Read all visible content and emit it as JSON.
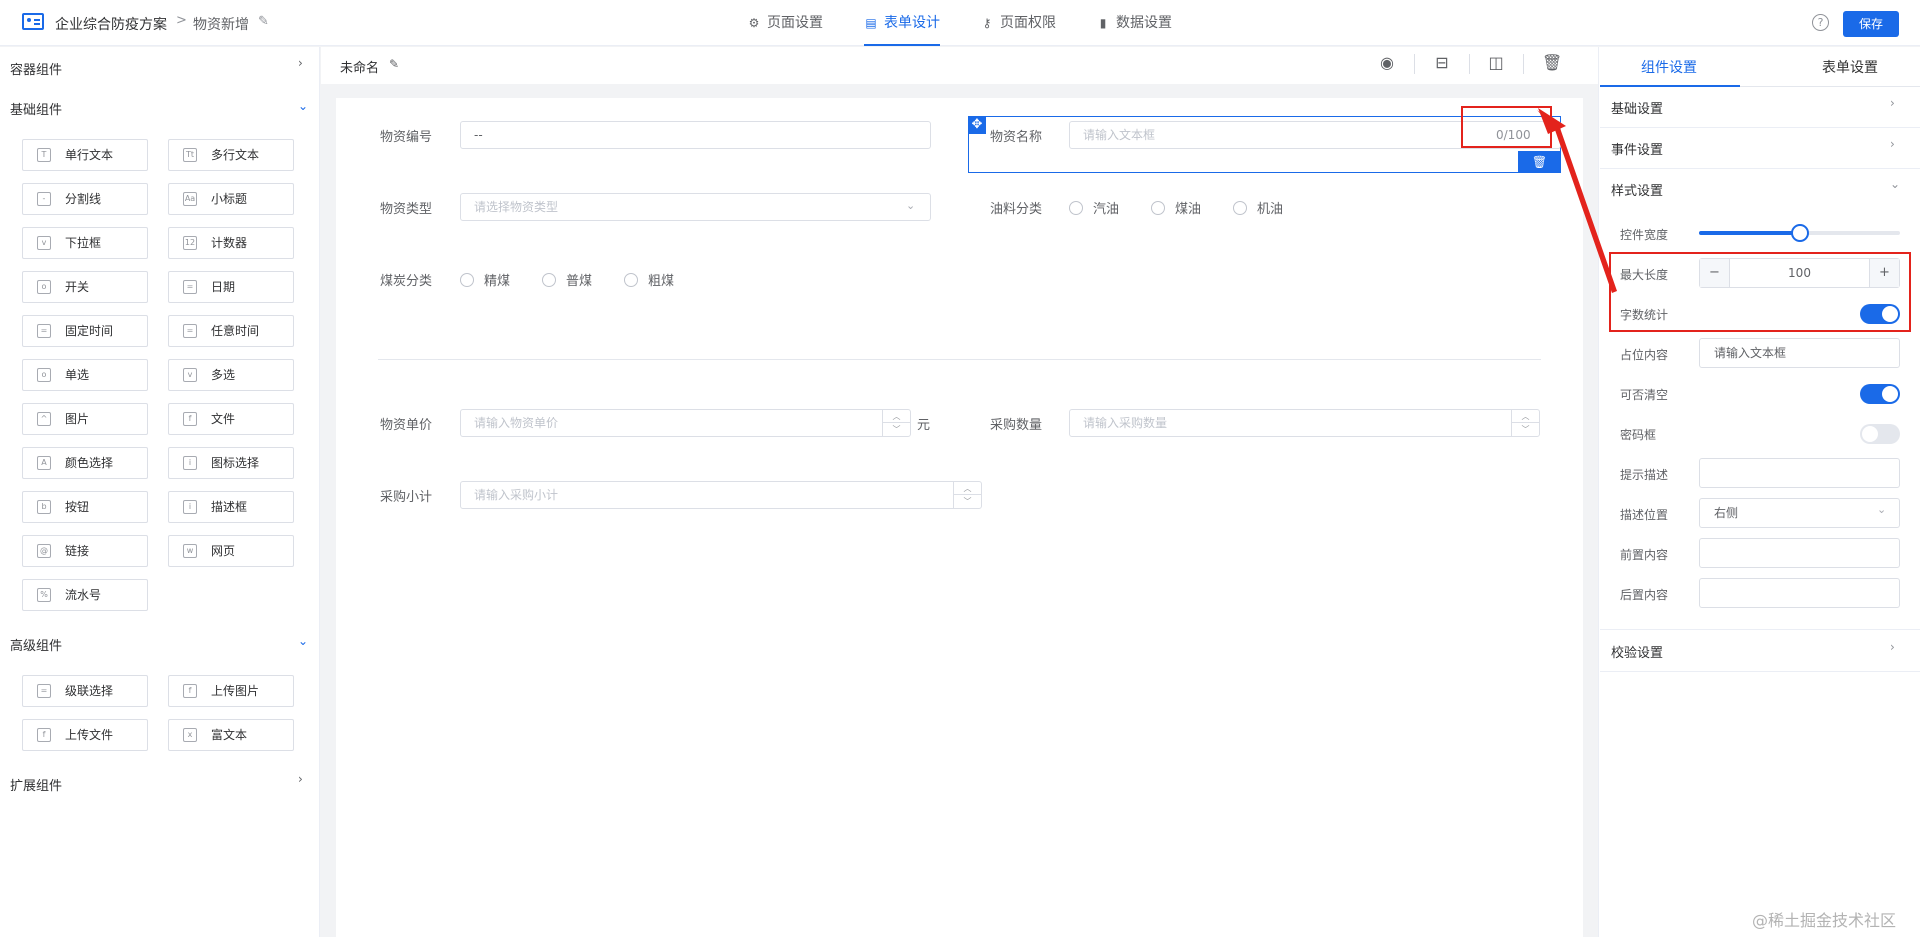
{
  "header": {
    "app_name": "企业综合防疫方案",
    "breadcrumb_sep": ">",
    "page_name": "物资新增",
    "tabs": [
      {
        "label": "页面设置",
        "icon": "gear-icon",
        "active": false
      },
      {
        "label": "表单设计",
        "icon": "document-icon",
        "active": true
      },
      {
        "label": "页面权限",
        "icon": "key-icon",
        "active": false
      },
      {
        "label": "数据设置",
        "icon": "bar-chart-icon",
        "active": false
      }
    ],
    "help_symbol": "?",
    "save_label": "保存"
  },
  "left": {
    "container_group": "容器组件",
    "basic_group": "基础组件",
    "basic_items": [
      {
        "label": "单行文本",
        "icon": "T"
      },
      {
        "label": "多行文本",
        "icon": "Tt"
      },
      {
        "label": "分割线",
        "icon": "-"
      },
      {
        "label": "小标题",
        "icon": "Aa"
      },
      {
        "label": "下拉框",
        "icon": "v"
      },
      {
        "label": "计数器",
        "icon": "12"
      },
      {
        "label": "开关",
        "icon": "o"
      },
      {
        "label": "日期",
        "icon": "="
      },
      {
        "label": "固定时间",
        "icon": "="
      },
      {
        "label": "任意时间",
        "icon": "="
      },
      {
        "label": "单选",
        "icon": "o"
      },
      {
        "label": "多选",
        "icon": "v"
      },
      {
        "label": "图片",
        "icon": "^"
      },
      {
        "label": "文件",
        "icon": "f"
      },
      {
        "label": "颜色选择",
        "icon": "A"
      },
      {
        "label": "图标选择",
        "icon": "i"
      },
      {
        "label": "按钮",
        "icon": "b"
      },
      {
        "label": "描述框",
        "icon": "i"
      },
      {
        "label": "链接",
        "icon": "@"
      },
      {
        "label": "网页",
        "icon": "w"
      },
      {
        "label": "流水号",
        "icon": "%"
      }
    ],
    "advanced_group": "高级组件",
    "advanced_items": [
      {
        "label": "级联选择",
        "icon": "="
      },
      {
        "label": "上传图片",
        "icon": "f"
      },
      {
        "label": "上传文件",
        "icon": "f"
      },
      {
        "label": "富文本",
        "icon": "x"
      }
    ],
    "extension_group": "扩展组件"
  },
  "middle": {
    "form_title": "未命名",
    "fields": {
      "code_label": "物资编号",
      "code_value": "--",
      "name_label": "物资名称",
      "name_placeholder": "请输入文本框",
      "name_counter": "0/100",
      "type_label": "物资类型",
      "type_placeholder": "请选择物资类型",
      "oil_label": "油料分类",
      "oil_options": [
        "汽油",
        "煤油",
        "机油"
      ],
      "coal_label": "煤炭分类",
      "coal_options": [
        "精煤",
        "普煤",
        "粗煤"
      ],
      "price_label": "物资单价",
      "price_placeholder": "请输入物资单价",
      "price_unit": "元",
      "qty_label": "采购数量",
      "qty_placeholder": "请输入采购数量",
      "subtotal_label": "采购小计",
      "subtotal_placeholder": "请输入采购小计"
    }
  },
  "right": {
    "tabs": [
      "组件设置",
      "表单设置"
    ],
    "sections": {
      "basic": "基础设置",
      "event": "事件设置",
      "style": "样式设置",
      "validation": "校验设置"
    },
    "style": {
      "width_label": "控件宽度",
      "width_value": 0.5,
      "maxlen_label": "最大长度",
      "maxlen_value": "100",
      "minus": "−",
      "plus": "+",
      "wordcount_label": "字数统计",
      "wordcount_on": true,
      "placeholder_label": "占位内容",
      "placeholder_value": "请输入文本框",
      "clearable_label": "可否清空",
      "clearable_on": true,
      "password_label": "密码框",
      "password_on": false,
      "hint_label": "提示描述",
      "hint_value": "",
      "hint_pos_label": "描述位置",
      "hint_pos_value": "右侧",
      "prefix_label": "前置内容",
      "prefix_value": "",
      "suffix_label": "后置内容",
      "suffix_value": ""
    }
  },
  "colors": {
    "accent": "#1a6ae8",
    "annotation": "#e3231c"
  },
  "watermark": "@稀土掘金技术社区"
}
